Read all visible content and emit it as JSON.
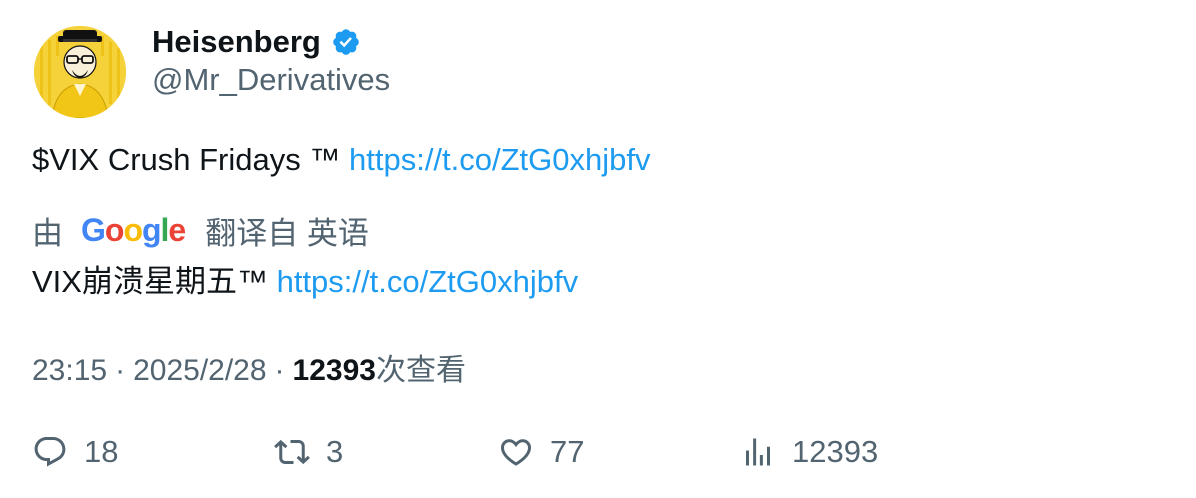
{
  "author": {
    "display_name": "Heisenberg",
    "handle": "@Mr_Derivatives",
    "verified": true,
    "avatar_icon": "heisenberg-avatar"
  },
  "tweet": {
    "text": "$VIX Crush Fridays ™",
    "link": "https://t.co/ZtG0xhjbfv"
  },
  "translation": {
    "by_label": "由",
    "provider": "Google",
    "from_label": "翻译自 英语",
    "text": "VIX崩溃星期五™",
    "link": "https://t.co/ZtG0xhjbfv"
  },
  "meta": {
    "time": "23:15",
    "separator": "·",
    "date": "2025/2/28",
    "views_count": "12393",
    "views_label": "次查看"
  },
  "actions": {
    "replies": "18",
    "retweets": "3",
    "likes": "77",
    "views": "12393"
  },
  "colors": {
    "link": "#1d9bf0",
    "secondary_text": "#536471",
    "primary_text": "#0f1419",
    "verified": "#1d9bf0",
    "avatar_bg": "#f6d23a"
  }
}
